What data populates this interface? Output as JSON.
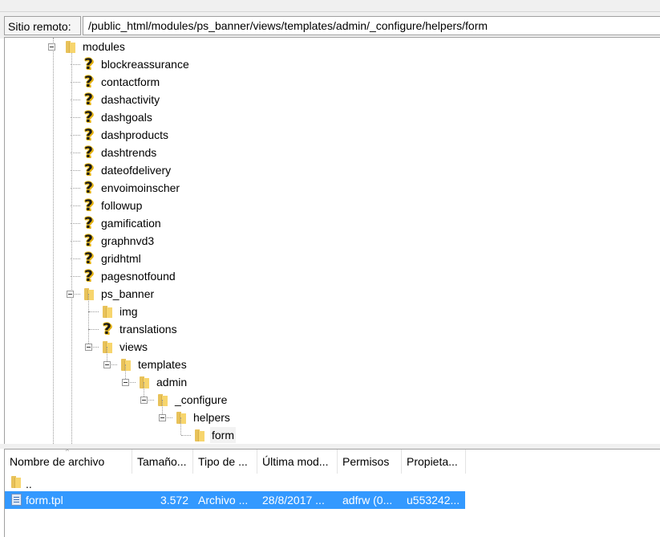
{
  "remote": {
    "label": "Sitio remoto:",
    "path": "/public_html/modules/ps_banner/views/templates/admin/_configure/helpers/form"
  },
  "tree": [
    {
      "label": "modules",
      "icon": "folder-icon"
    },
    {
      "label": "blockreassurance",
      "icon": "question-icon"
    },
    {
      "label": "contactform",
      "icon": "question-icon"
    },
    {
      "label": "dashactivity",
      "icon": "question-icon"
    },
    {
      "label": "dashgoals",
      "icon": "question-icon"
    },
    {
      "label": "dashproducts",
      "icon": "question-icon"
    },
    {
      "label": "dashtrends",
      "icon": "question-icon"
    },
    {
      "label": "dateofdelivery",
      "icon": "question-icon"
    },
    {
      "label": "envoimoinscher",
      "icon": "question-icon"
    },
    {
      "label": "followup",
      "icon": "question-icon"
    },
    {
      "label": "gamification",
      "icon": "question-icon"
    },
    {
      "label": "graphnvd3",
      "icon": "question-icon"
    },
    {
      "label": "gridhtml",
      "icon": "question-icon"
    },
    {
      "label": "pagesnotfound",
      "icon": "question-icon"
    },
    {
      "label": "ps_banner",
      "icon": "folder-icon"
    },
    {
      "label": "img",
      "icon": "folder-icon"
    },
    {
      "label": "translations",
      "icon": "question-icon"
    },
    {
      "label": "views",
      "icon": "folder-icon"
    },
    {
      "label": "templates",
      "icon": "folder-icon"
    },
    {
      "label": "admin",
      "icon": "folder-icon"
    },
    {
      "label": "_configure",
      "icon": "folder-icon"
    },
    {
      "label": "helpers",
      "icon": "folder-icon"
    },
    {
      "label": "form",
      "icon": "folder-icon"
    }
  ],
  "filelist": {
    "columns": [
      "Nombre de archivo",
      "Tamaño...",
      "Tipo de ...",
      "Última mod...",
      "Permisos",
      "Propieta..."
    ],
    "rows": [
      {
        "name": "..",
        "size": "",
        "type": "",
        "modified": "",
        "perms": "",
        "owner": "",
        "icon": "folder-icon"
      },
      {
        "name": "form.tpl",
        "size": "3.572",
        "type": "Archivo ...",
        "modified": "28/8/2017 ...",
        "perms": "adfrw (0...",
        "owner": "u553242...",
        "icon": "tpl-file-icon"
      }
    ]
  },
  "colors": {
    "selection": "#3399ff",
    "folder": "#f7d56d",
    "question": "#f3c521"
  }
}
